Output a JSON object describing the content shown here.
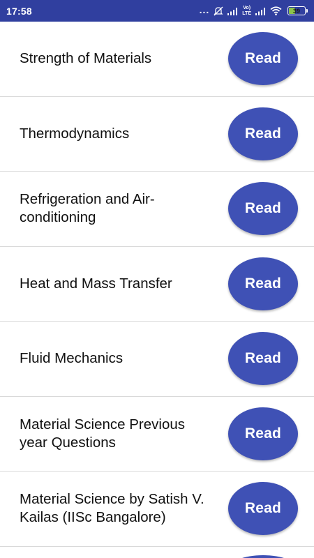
{
  "status_bar": {
    "time": "17:58",
    "dots": "...",
    "lte_top": "Vo)",
    "lte_bottom": "LTE",
    "battery_level": "39",
    "background_color": "#303f9f",
    "icons": [
      "mute-icon",
      "signal-icon",
      "volte-lte-icon",
      "signal-icon",
      "wifi-icon",
      "battery-icon"
    ]
  },
  "accent_color": "#3f51b5",
  "items": [
    {
      "title": "Strength of Materials",
      "button": "Read"
    },
    {
      "title": "Thermodynamics",
      "button": "Read"
    },
    {
      "title": "Refrigeration and Air-conditioning",
      "button": "Read"
    },
    {
      "title": "Heat and Mass Transfer",
      "button": "Read"
    },
    {
      "title": "Fluid Mechanics",
      "button": "Read"
    },
    {
      "title": "Material Science Previous year Questions",
      "button": "Read"
    },
    {
      "title": "Material Science by Satish V. Kailas (IISc Bangalore)",
      "button": "Read"
    }
  ]
}
